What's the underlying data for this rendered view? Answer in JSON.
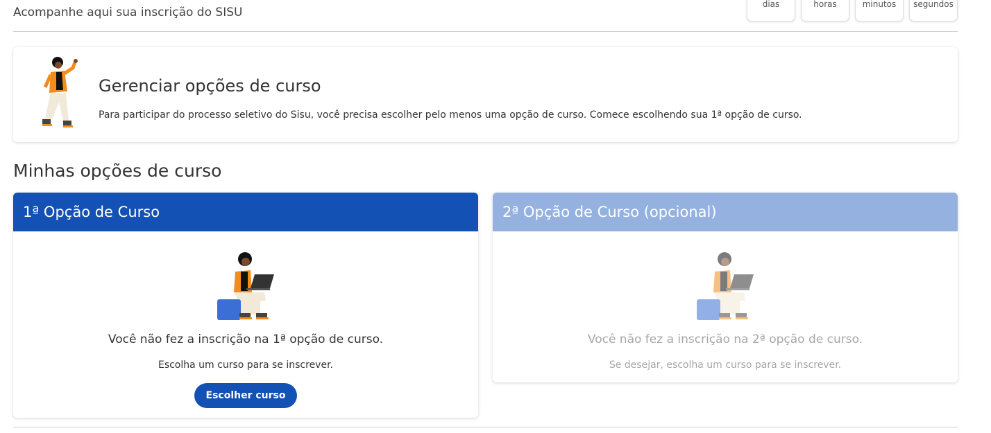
{
  "header": {
    "subtitle": "Acompanhe aqui sua inscrição do SISU",
    "countdown": {
      "days": "dias",
      "hours": "horas",
      "minutes": "minutos",
      "seconds": "segundos"
    }
  },
  "manage": {
    "title": "Gerenciar opções de curso",
    "description": "Para participar do processo seletivo do Sisu, você precisa escolher pelo menos uma opção de curso. Comece escolhendo sua 1ª opção de curso."
  },
  "options": {
    "section_title": "Minhas opções de curso",
    "first": {
      "title": "1ª Opção de Curso",
      "message": "Você não fez a inscrição na 1ª opção de curso.",
      "hint": "Escolha um curso para se inscrever.",
      "button": "Escolher curso"
    },
    "second": {
      "title": "2ª Opção de Curso (opcional)",
      "message": "Você não fez a inscrição na 2ª opção de curso.",
      "hint": "Se desejar, escolha um curso para se inscrever."
    }
  },
  "colors": {
    "primary": "#1351b4",
    "primary_light": "#94b1e0",
    "accent_orange": "#f28c1c"
  }
}
